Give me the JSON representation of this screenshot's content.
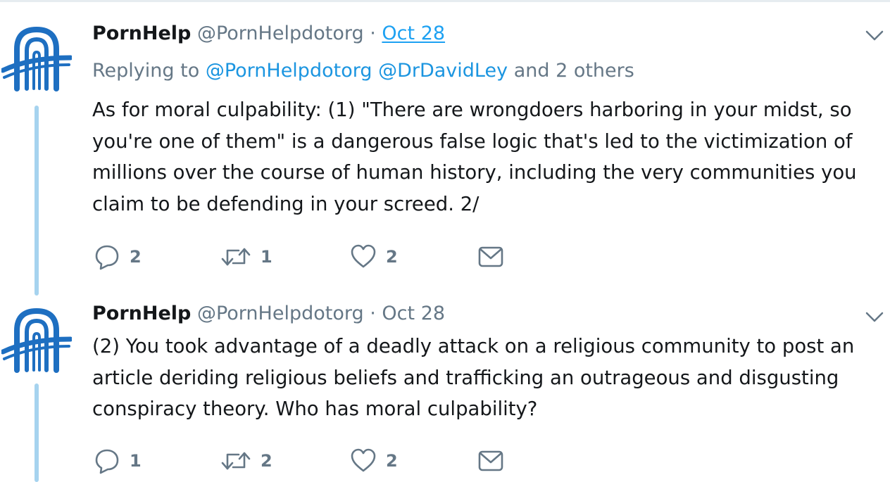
{
  "tweets": [
    {
      "name": "PornHelp",
      "handle": "@PornHelpdotorg",
      "separator": "·",
      "date": "Oct 28",
      "replying_prefix": "Replying to",
      "replying_mentions": [
        "@PornHelpdotorg",
        "@DrDavidLey"
      ],
      "replying_suffix": "and 2 others",
      "text_lines": [
        "As for moral culpability: (1) \"There are wrongdoers harboring in your midst, so",
        "you're one of them\" is a dangerous false logic that's led to the victimization of",
        "millions over the course of human history, including the very communities you",
        "claim to be defending in your screed. 2/"
      ],
      "reply_count": "2",
      "retweet_count": "1",
      "like_count": "2"
    },
    {
      "name": "PornHelp",
      "handle": "@PornHelpdotorg",
      "separator": "·",
      "date": "Oct 28",
      "text_lines": [
        "(2) You took advantage of a deadly attack on a religious community to post an",
        "article deriding religious beliefs and trafficking an outrageous and disgusting",
        "conspiracy theory. Who has moral culpability?"
      ],
      "reply_count": "1",
      "retweet_count": "2",
      "like_count": "2"
    }
  ],
  "icons": {
    "avatar": "arch-logo-icon",
    "reply": "reply-icon",
    "retweet": "retweet-icon",
    "like": "heart-icon",
    "dm": "envelope-icon",
    "more": "chevron-down-icon"
  },
  "colors": {
    "accent": "#1da1f2",
    "mention": "#1b95e0",
    "muted": "#657786",
    "thread_line": "#a6d3ef",
    "logo_blue": "#1e6fc1"
  }
}
